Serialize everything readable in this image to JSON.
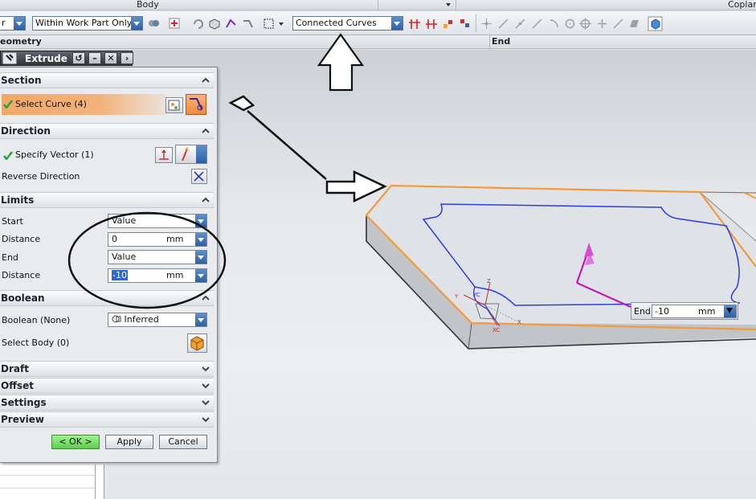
{
  "top_strip": {
    "body_label": "Body",
    "coplanar_label": "Coplan"
  },
  "toolbar": {
    "left_combo_value": "r",
    "scope_filter_value": "Within Work Part Only",
    "curve_rule_value": "Connected Curves"
  },
  "header_row": {
    "geometry_label": "eometry",
    "end_label": "End"
  },
  "dialog": {
    "title": "Extrude",
    "section": {
      "header": "Section",
      "select_curve_label": "Select Curve (4)"
    },
    "direction": {
      "header": "Direction",
      "specify_vector_label": "Specify Vector (1)",
      "reverse_direction_label": "Reverse Direction"
    },
    "limits": {
      "header": "Limits",
      "start_label": "Start",
      "start_option": "Value",
      "start_distance_label": "Distance",
      "start_distance_value": "0",
      "start_distance_unit": "mm",
      "end_label": "End",
      "end_option": "Value",
      "end_distance_label": "Distance",
      "end_distance_value": "-10",
      "end_distance_unit": "mm"
    },
    "boolean": {
      "header": "Boolean",
      "boolean_label": "Boolean (None)",
      "boolean_option": "Inferred",
      "select_body_label": "Select Body (0)"
    },
    "collapsed_sections": [
      "Draft",
      "Offset",
      "Settings",
      "Preview"
    ],
    "buttons": {
      "ok": "< OK >",
      "apply": "Apply",
      "cancel": "Cancel"
    }
  },
  "viewport": {
    "end_handle": {
      "label": "End",
      "value": "-10",
      "unit": "mm"
    },
    "triad_labels": {
      "z": "Z",
      "y": "Y",
      "yc": "YC",
      "xc": "XC",
      "x": "X"
    }
  },
  "colors": {
    "selected_edge": "#f39a3c",
    "curve": "#2b3fd9",
    "vector": "#c21ab5",
    "ok_button": "#66d455",
    "select_highlight": "#f2a86a"
  }
}
